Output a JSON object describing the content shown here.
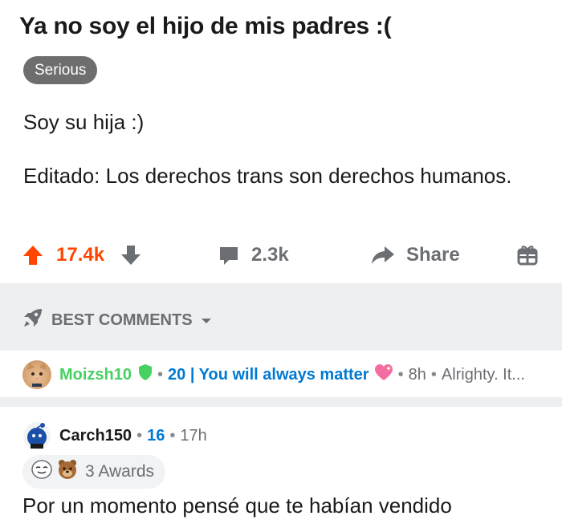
{
  "post": {
    "title": "Ya no soy el hijo de mis padres :(",
    "flair": "Serious",
    "body_line1": "Soy su hija :)",
    "body_line2": "Editado: Los derechos trans son derechos humanos."
  },
  "actions": {
    "upvotes": "17.4k",
    "comments": "2.3k",
    "share_label": "Share",
    "upvote_color": "#ff4500"
  },
  "sort": {
    "label": "BEST COMMENTS"
  },
  "comment1": {
    "username": "Moizsh10",
    "score_flair": "20 | You will always matter",
    "time": "8h",
    "preview": "Alrighty. It..."
  },
  "comment2": {
    "username": "Carch150",
    "score": "16",
    "time": "17h",
    "awards_label": "3 Awards",
    "text": "Por un momento pensé que te habían vendido"
  },
  "icons": [
    "upvote-arrow-icon",
    "downvote-arrow-icon",
    "comment-bubble-icon",
    "share-arrow-icon",
    "gift-icon",
    "rocket-icon",
    "chevron-down-icon",
    "shield-icon",
    "heart-icon"
  ]
}
